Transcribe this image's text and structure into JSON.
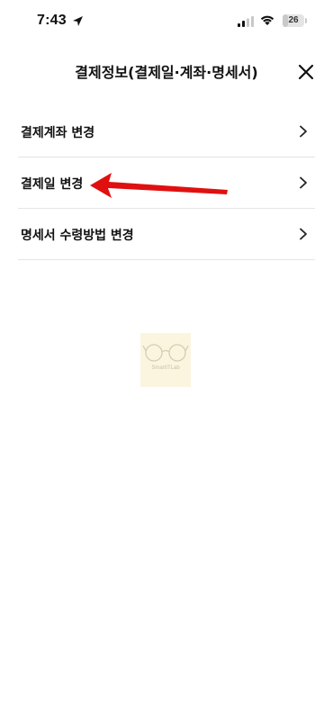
{
  "status_bar": {
    "time": "7:43",
    "battery": "26",
    "icons": [
      "location-arrow-icon",
      "cellular-signal-icon",
      "wifi-icon",
      "battery-icon"
    ]
  },
  "header": {
    "title": "결제정보(결제일·계좌·명세서)",
    "close_icon": "close-icon"
  },
  "menu": {
    "items": [
      {
        "label": "결제계좌 변경",
        "icon": "chevron-right-icon"
      },
      {
        "label": "결제일 변경",
        "icon": "chevron-right-icon"
      },
      {
        "label": "명세서 수령방법 변경",
        "icon": "chevron-right-icon"
      }
    ]
  },
  "annotation": {
    "icon": "red-arrow-icon",
    "color": "#e01010"
  },
  "watermark": {
    "text": "SmartITLab"
  },
  "colors": {
    "divider": "#e5e5e5",
    "text": "#111111",
    "arrow": "#e01010"
  }
}
